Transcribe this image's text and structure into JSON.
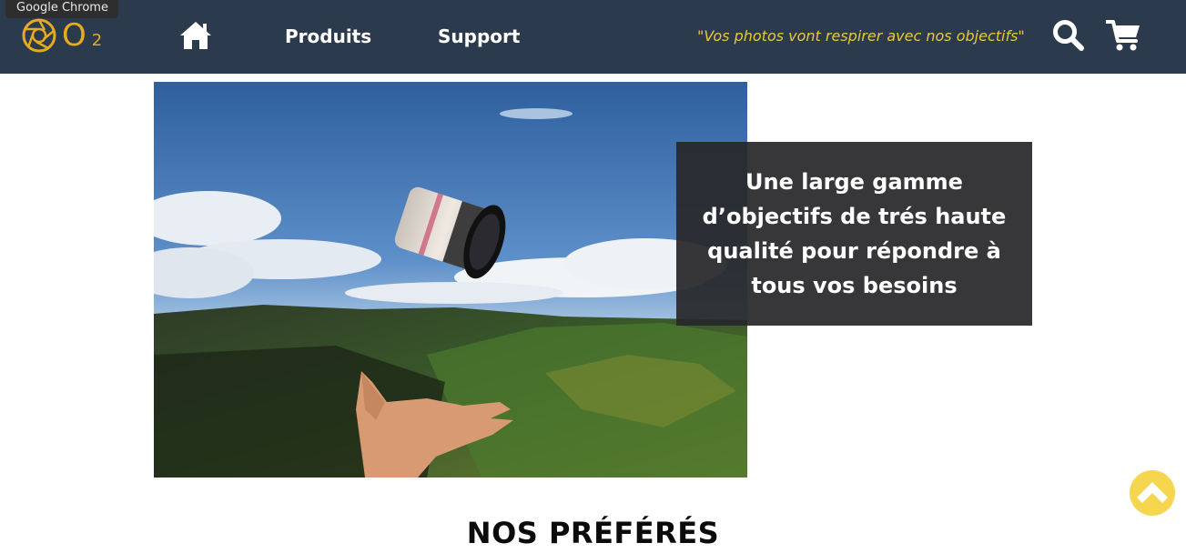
{
  "window": {
    "tooltip": "Google Chrome"
  },
  "header": {
    "logo": {
      "letter": "O",
      "subscript": "2"
    },
    "nav": {
      "home_icon": "home-icon",
      "produits": "Produits",
      "support": "Support"
    },
    "slogan": "\"Vos photos vont respirer avec nos objectifs\"",
    "search_icon": "search-icon",
    "cart_icon": "cart-icon"
  },
  "hero": {
    "image": "camera-lens-over-valley-photo",
    "caption": "Une large gamme d’objectifs de trés haute qualité pour répondre à tous vos besoins"
  },
  "section": {
    "title": "NOS PRÉFÉRÉS"
  },
  "scroll_top": {
    "icon": "chevron-up-icon"
  },
  "colors": {
    "navbar": "#2c3a4d",
    "logo": "#e5ac1f",
    "slogan": "#e9c93a",
    "caption_bg": "#28282a",
    "scroll_button": "#f5d64e"
  }
}
